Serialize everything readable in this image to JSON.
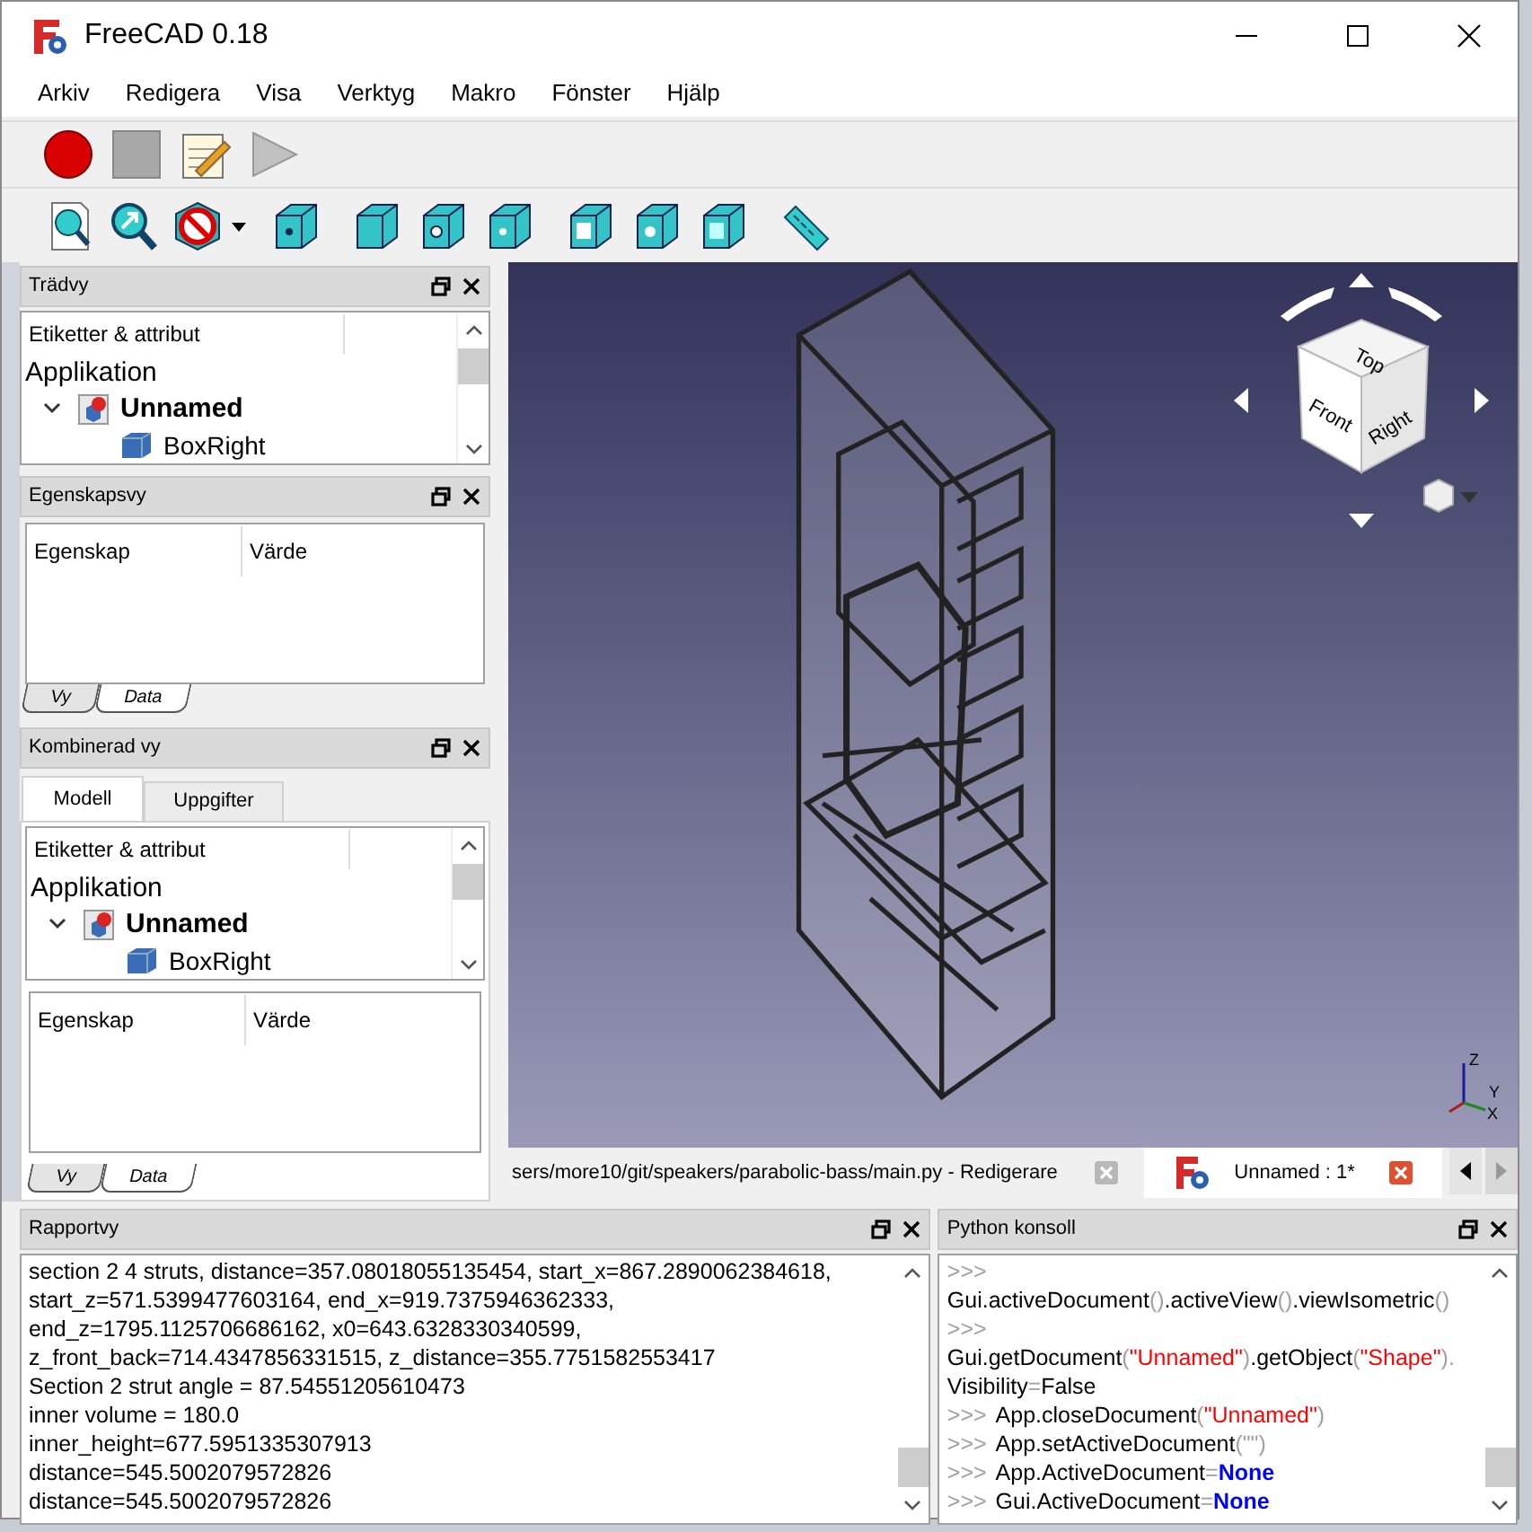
{
  "window": {
    "title": "FreeCAD 0.18"
  },
  "menu": [
    {
      "label": "Arkiv"
    },
    {
      "label": "Redigera"
    },
    {
      "label": "Visa"
    },
    {
      "label": "Verktyg"
    },
    {
      "label": "Makro"
    },
    {
      "label": "Fönster"
    },
    {
      "label": "Hjälp"
    }
  ],
  "tree_view": {
    "title": "Trädvy",
    "header": "Etiketter & attribut",
    "items": [
      {
        "label": "Applikation",
        "kind": "root",
        "children": [
          {
            "label": "Unnamed",
            "kind": "document",
            "children": [
              {
                "label": "BoxRight",
                "kind": "part"
              }
            ]
          }
        ]
      }
    ]
  },
  "property_view": {
    "title": "Egenskapsvy",
    "columns": [
      "Egenskap",
      "Värde"
    ],
    "tabs": [
      {
        "label": "Vy",
        "selected": false
      },
      {
        "label": "Data",
        "selected": true
      }
    ]
  },
  "combo_view": {
    "title": "Kombinerad vy",
    "tabs": [
      {
        "label": "Modell",
        "selected": true
      },
      {
        "label": "Uppgifter",
        "selected": false
      }
    ],
    "tree": {
      "header": "Etiketter & attribut",
      "items": [
        {
          "label": "Applikation",
          "kind": "root",
          "children": [
            {
              "label": "Unnamed",
              "kind": "document",
              "children": [
                {
                  "label": "BoxRight",
                  "kind": "part"
                }
              ]
            }
          ]
        }
      ]
    },
    "property": {
      "columns": [
        "Egenskap",
        "Värde"
      ],
      "tabs": [
        {
          "label": "Vy",
          "selected": false
        },
        {
          "label": "Data",
          "selected": true
        }
      ]
    }
  },
  "view3d": {
    "nav_cube": {
      "faces": [
        "Top",
        "Front",
        "Right"
      ]
    },
    "axes": [
      "Z",
      "Y",
      "X"
    ]
  },
  "document_tabs": [
    {
      "label": "sers/more10/git/speakers/parabolic-bass/main.py - Redigerare",
      "kind": "editor",
      "selected": false
    },
    {
      "label": "Unnamed : 1*",
      "kind": "document",
      "selected": true
    }
  ],
  "report_view": {
    "title": "Rapportvy",
    "lines": [
      "section 2 4 struts, distance=357.08018055135454, start_x=867.2890062384618,",
      "start_z=571.5399477603164, end_x=919.7375946362333,",
      "end_z=1795.1125706686162, x0=643.6328330340599,",
      "z_front_back=714.4347856331515, z_distance=355.7751582553417",
      "Section 2 strut angle = 87.54551205610473",
      "inner volume = 180.0",
      "inner_height=677.5951335307913",
      "distance=545.5002079572826",
      "distance=545.5002079572826"
    ]
  },
  "python_console": {
    "title": "Python konsoll",
    "lines": [
      [
        {
          "text": ">>>",
          "kind": "prompt"
        }
      ],
      [
        {
          "text": "Gui.activeDocument",
          "kind": "name"
        },
        {
          "text": "()",
          "kind": "punct"
        },
        {
          "text": ".activeView",
          "kind": "name"
        },
        {
          "text": "()",
          "kind": "punct"
        },
        {
          "text": ".viewIsometric",
          "kind": "name"
        },
        {
          "text": "()",
          "kind": "punct"
        }
      ],
      [
        {
          "text": ">>>",
          "kind": "prompt"
        }
      ],
      [
        {
          "text": "Gui.getDocument",
          "kind": "name"
        },
        {
          "text": "(",
          "kind": "punct"
        },
        {
          "text": "\"Unnamed\"",
          "kind": "string"
        },
        {
          "text": ")",
          "kind": "punct"
        },
        {
          "text": ".getObject",
          "kind": "name"
        },
        {
          "text": "(",
          "kind": "punct"
        },
        {
          "text": "\"Shape\"",
          "kind": "string"
        },
        {
          "text": ").",
          "kind": "punct"
        }
      ],
      [
        {
          "text": "Visibility",
          "kind": "name"
        },
        {
          "text": "=",
          "kind": "punct"
        },
        {
          "text": "False",
          "kind": "name"
        }
      ],
      [
        {
          "text": ">>>",
          "kind": "prompt"
        },
        {
          "text": "App.closeDocument",
          "kind": "name"
        },
        {
          "text": "(",
          "kind": "punct"
        },
        {
          "text": "\"Unnamed\"",
          "kind": "string"
        },
        {
          "text": ")",
          "kind": "punct"
        }
      ],
      [
        {
          "text": ">>>",
          "kind": "prompt"
        },
        {
          "text": "App.setActiveDocument",
          "kind": "name"
        },
        {
          "text": "(\"\")",
          "kind": "punct"
        }
      ],
      [
        {
          "text": ">>>",
          "kind": "prompt"
        },
        {
          "text": "App.ActiveDocument",
          "kind": "name"
        },
        {
          "text": "=",
          "kind": "punct"
        },
        {
          "text": "None",
          "kind": "keyword"
        }
      ],
      [
        {
          "text": ">>>",
          "kind": "prompt"
        },
        {
          "text": "Gui.ActiveDocument",
          "kind": "name"
        },
        {
          "text": "=",
          "kind": "punct"
        },
        {
          "text": "None",
          "kind": "keyword"
        }
      ]
    ]
  }
}
